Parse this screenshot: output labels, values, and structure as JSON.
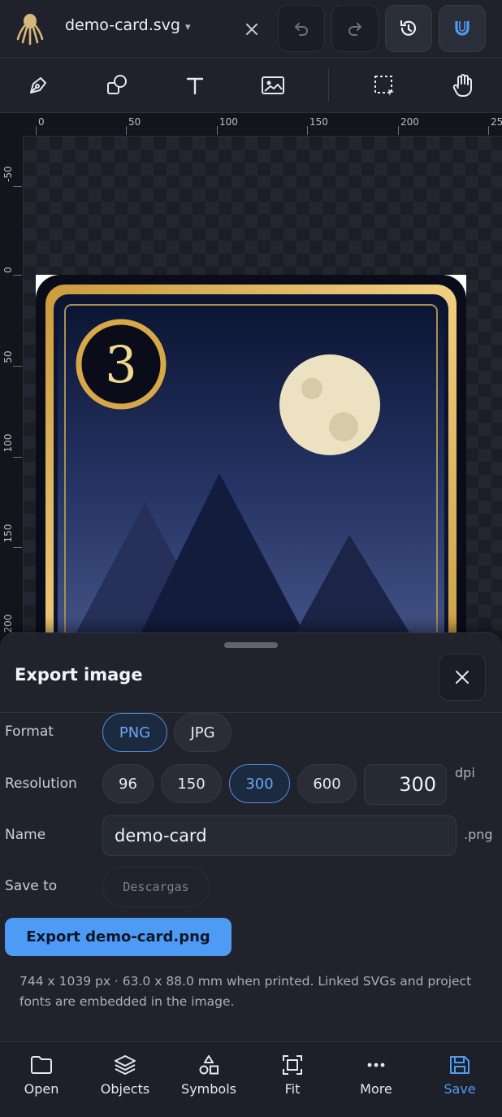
{
  "header": {
    "filename": "demo-card.svg",
    "filename_caret": "▾",
    "icons": [
      "logo-icon",
      "close-icon",
      "undo-icon",
      "redo-icon",
      "history-icon",
      "magnet-icon"
    ]
  },
  "toolbar": {
    "tools": [
      "pen-tool-icon",
      "shapes-icon",
      "text-tool-icon",
      "image-icon",
      "marquee-select-icon",
      "hand-pan-icon"
    ]
  },
  "rulers": {
    "horizontal": [
      "0",
      "50",
      "100",
      "150",
      "200",
      "25"
    ],
    "vertical": [
      "-50",
      "0",
      "50",
      "100",
      "150",
      "200"
    ]
  },
  "card": {
    "number": "3",
    "colors": {
      "gold": "#d6a848",
      "navy": "#0d1430",
      "moon": "#ece2c2"
    }
  },
  "export_sheet": {
    "title": "Export image",
    "format_label": "Format",
    "formats": [
      "PNG",
      "JPG"
    ],
    "selected_format": "PNG",
    "resolution_label": "Resolution",
    "resolutions": [
      "96",
      "150",
      "300",
      "600"
    ],
    "selected_resolution": "300",
    "dpi_value": "300",
    "dpi_unit": "dpi",
    "name_label": "Name",
    "name_value": "demo-card",
    "name_ext": ".png",
    "save_to_label": "Save to",
    "save_to_value": "Descargas",
    "export_button": "Export demo-card.png",
    "info": "744 x 1039 px · 63.0 x 88.0 mm when printed. Linked SVGs and project fonts are embedded in the image."
  },
  "bottom_nav": [
    {
      "label": "Open",
      "icon": "folder-icon"
    },
    {
      "label": "Objects",
      "icon": "layers-icon"
    },
    {
      "label": "Symbols",
      "icon": "symbols-icon"
    },
    {
      "label": "Fit",
      "icon": "fit-icon"
    },
    {
      "label": "More",
      "icon": "more-icon"
    },
    {
      "label": "Save",
      "icon": "save-icon",
      "active": true
    }
  ],
  "colors": {
    "accent": "#4d9bf5",
    "background": "#1e212a"
  }
}
